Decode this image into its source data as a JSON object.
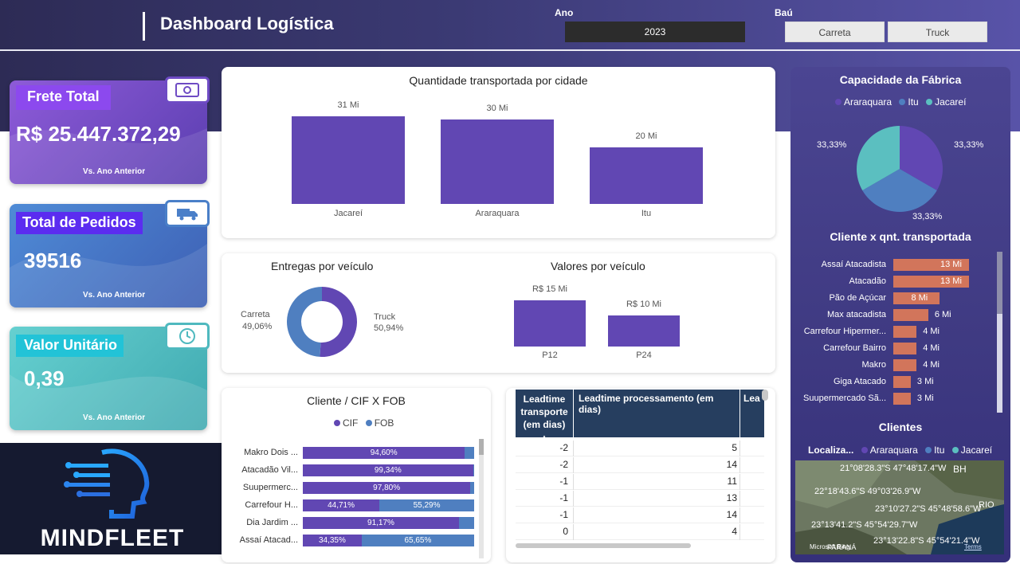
{
  "header": {
    "title": "Dashboard Logística",
    "ano_label": "Ano",
    "ano_value": "2023",
    "bau_label": "Baú",
    "bau_options": [
      "Carreta",
      "Truck"
    ]
  },
  "kpis": {
    "frete": {
      "label": "Frete Total",
      "value": "R$ 25.447.372,29",
      "foot": "Vs. Ano Anterior",
      "icon": "money-icon"
    },
    "pedidos": {
      "label": "Total de Pedidos",
      "value": "39516",
      "foot": "Vs. Ano Anterior",
      "icon": "truck-icon"
    },
    "unitario": {
      "label": "Valor Unitário",
      "value": "0,39",
      "foot": "Vs. Ano Anterior",
      "icon": "clock-icon"
    }
  },
  "logo": {
    "text": "MINDFLEET"
  },
  "colors": {
    "primary": "#6147b3",
    "secondary": "#4f7fc0",
    "accent": "#d2755b",
    "teal": "#5bbfc0"
  },
  "chart_data": [
    {
      "type": "bar",
      "title": "Quantidade transportada por cidade",
      "categories": [
        "Jacareí",
        "Araraquara",
        "Itu"
      ],
      "values": [
        31,
        30,
        20
      ],
      "value_labels": [
        "31 Mi",
        "30 Mi",
        "20 Mi"
      ]
    },
    {
      "type": "pie",
      "title": "Entregas por veículo",
      "categories": [
        "Carreta",
        "Truck"
      ],
      "values": [
        49.06,
        50.94
      ],
      "value_labels": [
        "49,06%",
        "50,94%"
      ]
    },
    {
      "type": "bar",
      "title": "Valores por veículo",
      "categories": [
        "P12",
        "P24"
      ],
      "values": [
        15,
        10
      ],
      "value_labels": [
        "R$ 15 Mi",
        "R$ 10 Mi"
      ]
    },
    {
      "type": "bar",
      "title": "Cliente / CIF X FOB",
      "legend": [
        "CIF",
        "FOB"
      ],
      "categories": [
        "Makro Dois ...",
        "Atacadão Vil...",
        "Suupermerc...",
        "Carrefour H...",
        "Dia Jardim ...",
        "Assaí Atacad..."
      ],
      "series": [
        {
          "name": "CIF",
          "values": [
            94.6,
            99.34,
            97.8,
            44.71,
            91.17,
            34.35
          ],
          "labels": [
            "94,60%",
            "99,34%",
            "97,80%",
            "44,71%",
            "91,17%",
            "34,35%"
          ]
        },
        {
          "name": "FOB",
          "values": [
            5.4,
            0.66,
            2.2,
            55.29,
            8.83,
            65.65
          ],
          "labels": [
            "",
            "",
            "",
            "55,29%",
            "",
            "65,65%"
          ]
        }
      ]
    },
    {
      "type": "pie",
      "title": "Capacidade da Fábrica",
      "categories": [
        "Araraquara",
        "Itu",
        "Jacareí"
      ],
      "values": [
        33.33,
        33.33,
        33.33
      ],
      "value_labels": [
        "33,33%",
        "33,33%",
        "33,33%"
      ]
    },
    {
      "type": "bar",
      "title": "Cliente x qnt. transportada",
      "categories": [
        "Assaí Atacadista",
        "Atacadão",
        "Pão de Açúcar",
        "Max atacadista",
        "Carrefour Hipermer...",
        "Carrefour Bairro",
        "Makro",
        "Giga Atacado",
        "Suupermercado Sã..."
      ],
      "values": [
        13,
        13,
        8,
        6,
        4,
        4,
        4,
        3,
        3
      ],
      "value_labels": [
        "13 Mi",
        "13 Mi",
        "8 Mi",
        "6 Mi",
        "4 Mi",
        "4 Mi",
        "4 Mi",
        "3 Mi",
        "3 Mi"
      ]
    }
  ],
  "table": {
    "headers": [
      "Leadtime transporte (em dias)",
      "Leadtime processamento (em dias)",
      "Lea"
    ],
    "rows": [
      [
        "-2",
        "5"
      ],
      [
        "-2",
        "14"
      ],
      [
        "-1",
        "11"
      ],
      [
        "-1",
        "13"
      ],
      [
        "-1",
        "14"
      ],
      [
        "0",
        "4"
      ]
    ]
  },
  "map": {
    "title": "Clientes",
    "legend_label": "Localiza...",
    "legend": [
      "Araraquara",
      "Itu",
      "Jacareí"
    ],
    "coords": [
      "21°08'28.3\"S 47°48'17.4\"W",
      "22°18'43.6\"S 49°03'26.9\"W",
      "23°10'27.2\"S 45°48'58.6\"W",
      "23°13'41.2\"S 45°54'29.7\"W",
      "23°13'22.8\"S 45°54'21.4\"W"
    ],
    "places": [
      "BH",
      "RIO",
      "PARANÁ"
    ],
    "attribution": "Microsoft Bing",
    "terms": "Terms"
  }
}
